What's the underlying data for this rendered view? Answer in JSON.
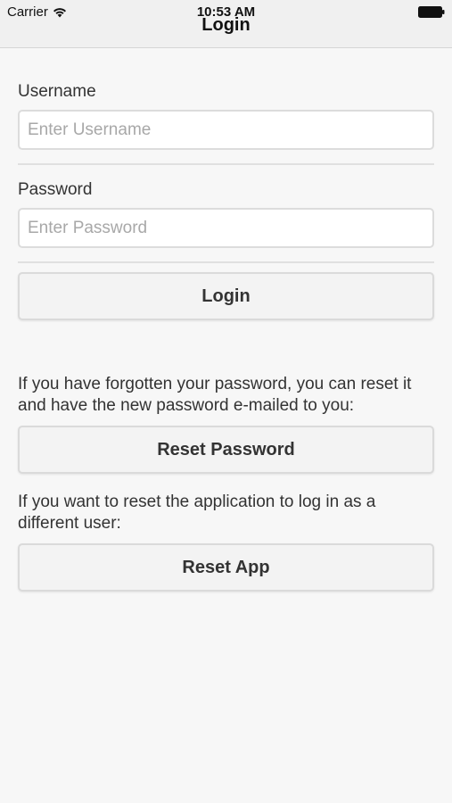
{
  "status_bar": {
    "carrier": "Carrier",
    "time": "10:53 AM"
  },
  "nav": {
    "title": "Login"
  },
  "form": {
    "username_label": "Username",
    "username_placeholder": "Enter Username",
    "password_label": "Password",
    "password_placeholder": "Enter Password",
    "login_button": "Login"
  },
  "reset_password": {
    "info": "If you have forgotten your password, you can reset it and have the new password e-mailed to you:",
    "button": "Reset Password"
  },
  "reset_app": {
    "info": "If you want to reset the application to log in as a different user:",
    "button": "Reset App"
  },
  "icons": {
    "wifi": "wifi-icon",
    "battery": "battery-icon"
  },
  "colors": {
    "background": "#f7f7f7",
    "header": "#f0f0f0",
    "button": "#f3f3f3",
    "placeholder": "#a8a8a8"
  }
}
